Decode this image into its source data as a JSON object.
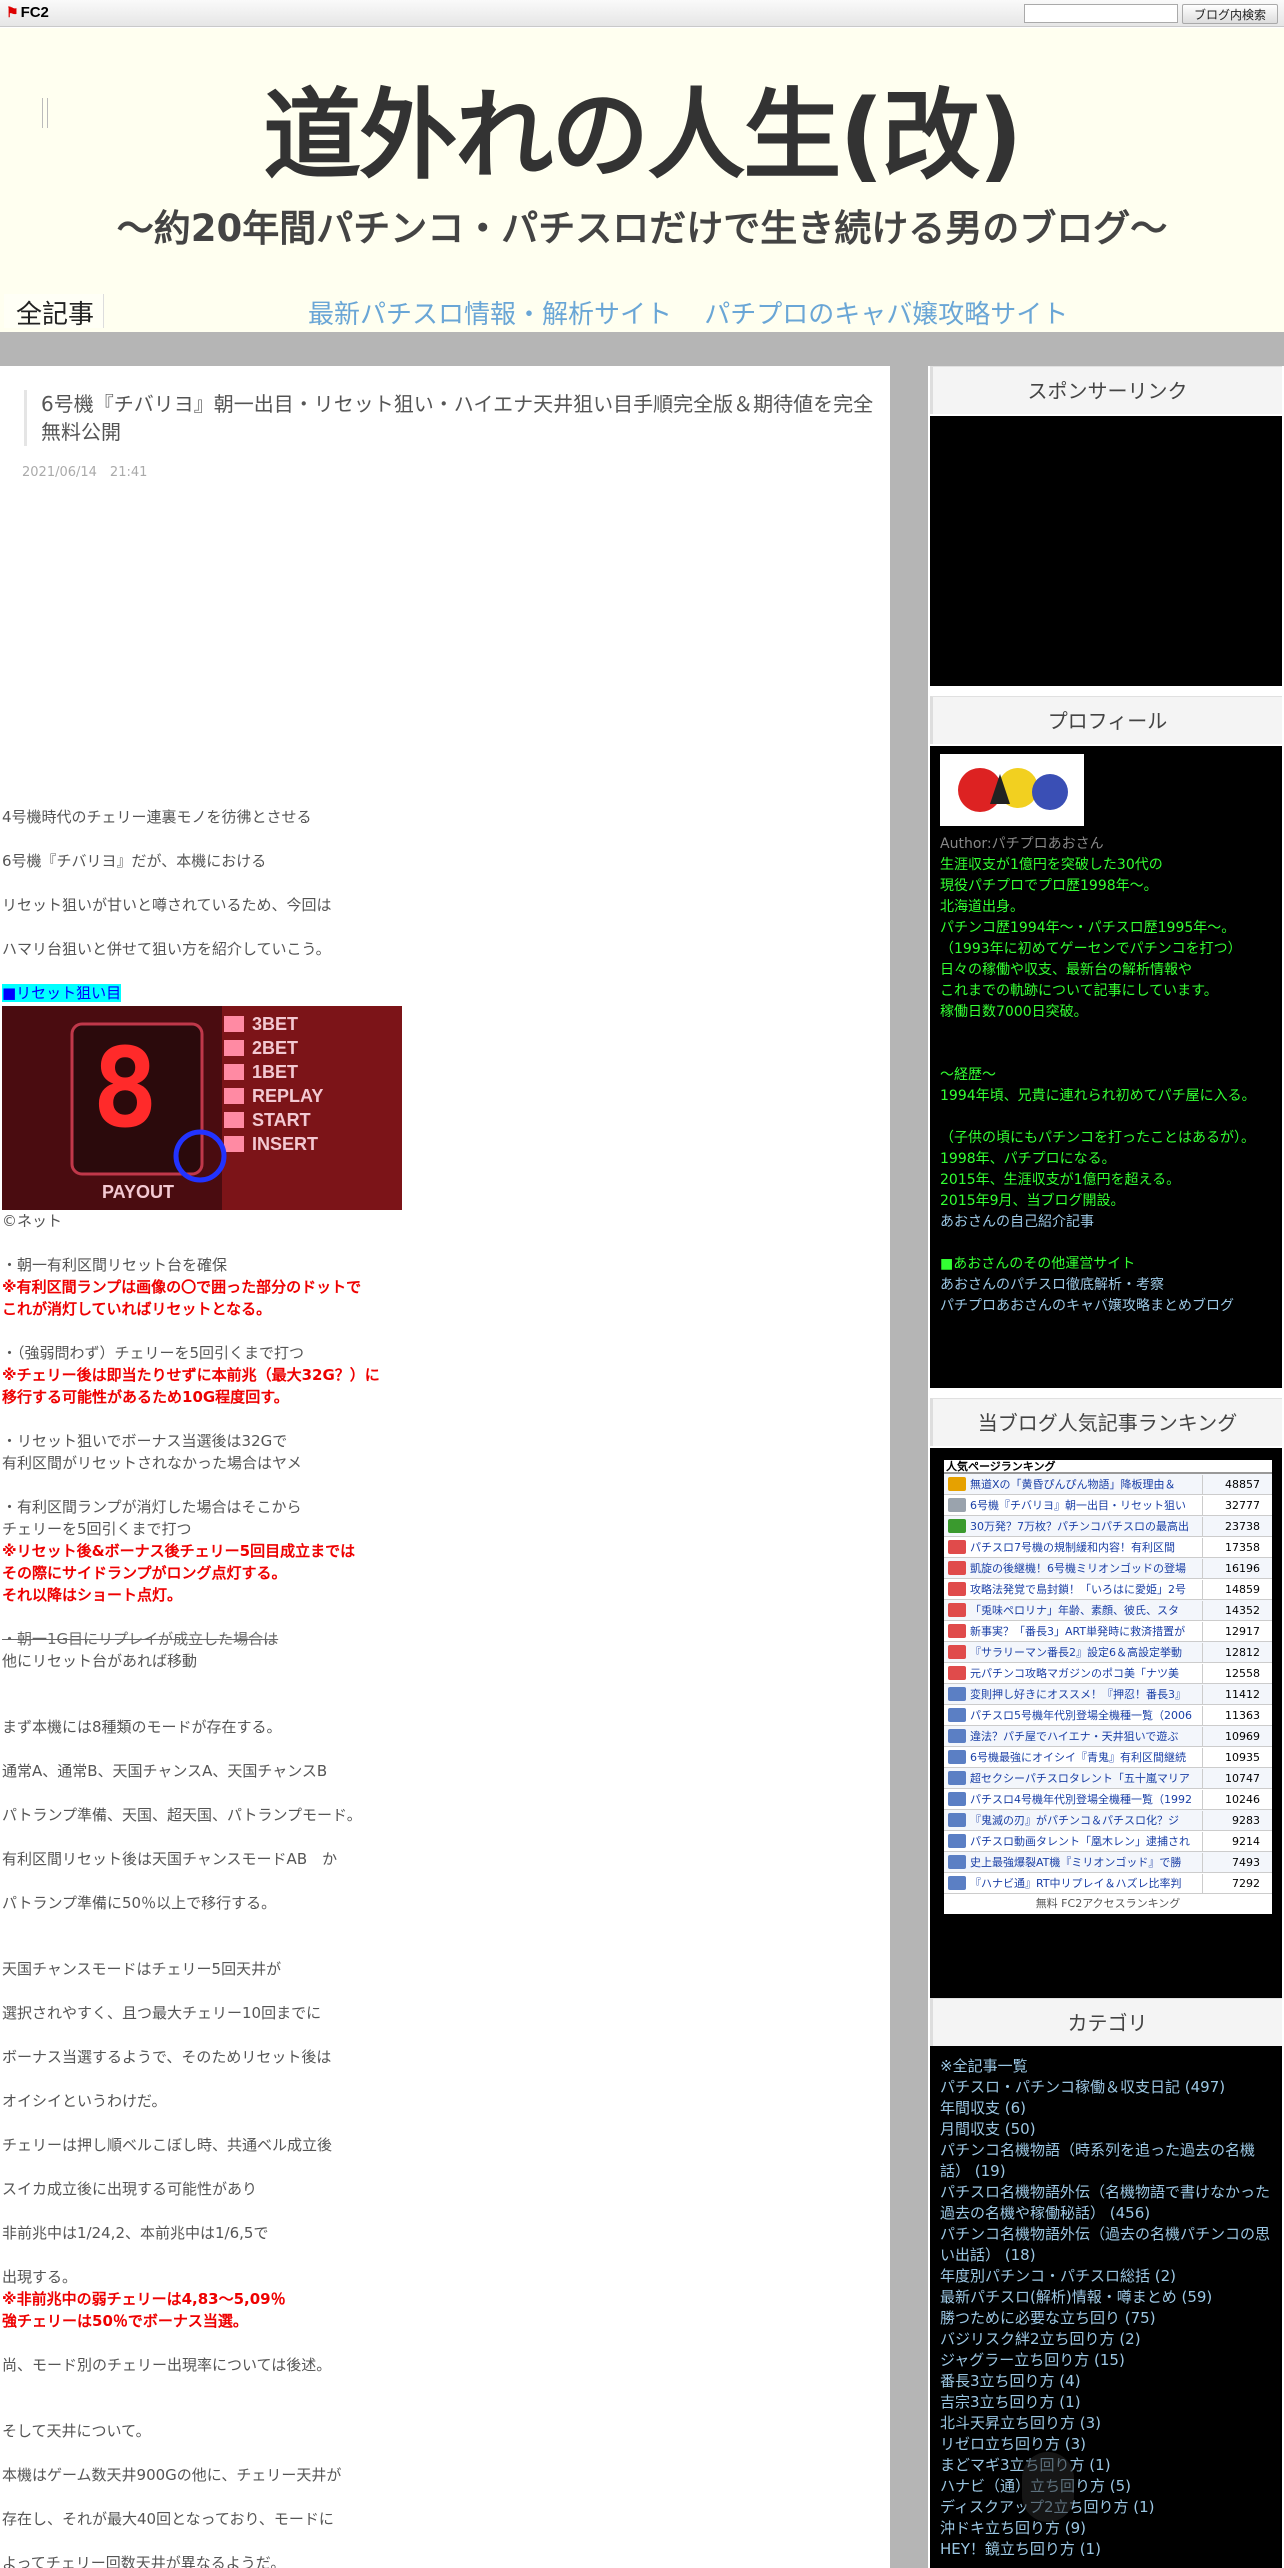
{
  "topbar": {
    "logo": "FC2",
    "search_placeholder": "",
    "search_button": "ブログ内検索"
  },
  "header": {
    "title": "道外れの人生(改)",
    "subtitle": "～約20年間パチンコ・パチスロだけで生き続ける男のブログ～",
    "all_posts": "全記事",
    "links": [
      "最新パチスロ情報・解析サイト",
      "パチプロのキャバ嬢攻略サイト"
    ]
  },
  "post": {
    "title": "6号機『チバリヨ』朝一出目・リセット狙い・ハイエナ天井狙い目手順完全版＆期待値を完全無料公開",
    "date": "2021/06/14　21:41",
    "intro": [
      "4号機時代のチェリー連裏モノを彷彿とさせる",
      "6号機『チバリヨ』だが、本機における",
      "リセット狙いが甘いと噂されているため、今回は",
      "ハマリ台狙いと併せて狙い方を紹介していこう。"
    ],
    "reset_heading": "■リセット狙い目",
    "photo_caption": "©ネット",
    "photo_labels": [
      "3BET",
      "2BET",
      "1BET",
      "REPLAY",
      "START",
      "INSERT",
      "PAYOUT"
    ],
    "list1": "・朝一有利区間リセット台を確保",
    "list1_red": [
      "※有利区間ランプは画像の〇で囲った部分のドットで",
      "これが消灯していればリセットとなる。"
    ],
    "list2": "・（強弱問わず）チェリーを5回引くまで打つ",
    "list2_red": [
      "※チェリー後は即当たりせずに本前兆（最大32G？）に",
      "移行する可能性があるため10G程度回す。"
    ],
    "list3": [
      "・リセット狙いでボーナス当選後は32Gで",
      "有利区間がリセットされなかった場合はヤメ"
    ],
    "list4": [
      "・有利区間ランプが消灯した場合はそこから",
      "チェリーを5回引くまで打つ"
    ],
    "list4_red": [
      "※リセット後&ボーナス後チェリー5回目成立までは",
      "その際にサイドランプがロング点灯する。",
      "それ以降はショート点灯。"
    ],
    "strike": "・朝一1G目にリプレイが成立した場合は",
    "strike_after": "他にリセット台があれば移動",
    "mode_lines": [
      "まず本機には8種類のモードが存在する。",
      "通常A、通常B、天国チャンスA、天国チャンスB",
      "パトランプ準備、天国、超天国、パトランプモード。",
      "有利区間リセット後は天国チャンスモードAB　か",
      "パトランプ準備に50％以上で移行する。"
    ],
    "tengoku_lines": [
      "天国チャンスモードはチェリー5回天井が",
      "選択されやすく、且つ最大チェリー10回までに",
      "ボーナス当選するようで、そのためリセット後は",
      "オイシイというわけだ。",
      "チェリーは押し順ベルこぼし時、共通ベル成立後",
      "スイカ成立後に出現する可能性があり",
      "非前兆中は1/24,2、本前兆中は1/6,5で",
      "出現する。"
    ],
    "cherry_red": [
      "※非前兆中の弱チェリーは4,83～5,09％",
      "強チェリーは50％でボーナス当選。"
    ],
    "mode_note": "尚、モード別のチェリー出現率については後述。",
    "tenjo_lines": [
      "そして天井について。",
      "本機はゲーム数天井900Gの他に、チェリー天井が",
      "存在し、それが最大40回となっており、モードに",
      "よってチェリー回数天井が異なるようだ。"
    ]
  },
  "sidebar": {
    "sponsor_title": "スポンサーリンク",
    "profile_title": "プロフィール",
    "profile_author": "Author:パチプロあおさん",
    "profile_lines": [
      "生涯収支が1億円を突破した30代の",
      "現役パチプロでプロ歴1998年～。",
      "北海道出身。",
      "パチンコ歴1994年～・パチスロ歴1995年～。",
      "（1993年に初めてゲーセンでパチンコを打つ）",
      "日々の稼働や収支、最新台の解析情報や",
      "これまでの軌跡について記事にしています。",
      "稼働日数7000日突破。"
    ],
    "career_lines": [
      "～経歴～",
      "1994年頃、兄貴に連れられ初めてパチ屋に入る。",
      "",
      "（子供の頃にもパチンコを打ったことはあるが）。",
      "1998年、パチプロになる。",
      "2015年、生涯収支が1億円を超える。",
      "2015年9月、当ブログ開設。"
    ],
    "intro_link": "あおさんの自己紹介記事",
    "other_title": "■あおさんのその他運営サイト",
    "other_links": [
      "あおさんのパチスロ徹底解析・考察",
      "パチプロあおさんのキャバ嬢攻略まとめブログ"
    ],
    "ranking_title": "当ブログ人気記事ランキング",
    "ranking_head": "人気ページランキング",
    "ranking": [
      {
        "title": "無道Xの「黄昏ぴんぴん物語」降板理由＆",
        "count": "48857",
        "color": "#e6a100"
      },
      {
        "title": "6号機『チバリヨ』朝一出目・リセット狙い",
        "count": "32777",
        "color": "#9aa3ad"
      },
      {
        "title": "30万発？7万枚？パチンコパチスロの最高出",
        "count": "23738",
        "color": "#3a9a2e"
      },
      {
        "title": "パチスロ7号機の規制緩和内容！有利区間",
        "count": "17358",
        "color": "#e04b4b"
      },
      {
        "title": "凱旋の後継機！6号機ミリオンゴッドの登場",
        "count": "16196",
        "color": "#e04b4b"
      },
      {
        "title": "攻略法発覚で島封鎖！「いろはに愛姫」2号",
        "count": "14859",
        "color": "#e04b4b"
      },
      {
        "title": "「兎味ペロリナ」年齢、素顔、彼氏、スタ",
        "count": "14352",
        "color": "#e04b4b"
      },
      {
        "title": "新事実？「番長3」ART単発時に救済措置が",
        "count": "12917",
        "color": "#e04b4b"
      },
      {
        "title": "『サラリーマン番長2』設定6＆高設定挙動",
        "count": "12812",
        "color": "#e04b4b"
      },
      {
        "title": "元パチンコ攻略マガジンのポコ美「ナツ美",
        "count": "12558",
        "color": "#e04b4b"
      },
      {
        "title": "変則押し好きにオススメ！『押忍！番長3』",
        "count": "11412",
        "color": "#5b7fc4"
      },
      {
        "title": "パチスロ5号機年代別登場全機種一覧（2006",
        "count": "11363",
        "color": "#5b7fc4"
      },
      {
        "title": "違法？パチ屋でハイエナ・天井狙いで遊ぶ",
        "count": "10969",
        "color": "#5b7fc4"
      },
      {
        "title": "6号機最強にオイシイ『青鬼』有利区間継続",
        "count": "10935",
        "color": "#5b7fc4"
      },
      {
        "title": "超セクシーパチスロタレント「五十嵐マリア",
        "count": "10747",
        "color": "#5b7fc4"
      },
      {
        "title": "パチスロ4号機年代別登場全機種一覧（1992",
        "count": "10246",
        "color": "#5b7fc4"
      },
      {
        "title": "『鬼滅の刃』がパチンコ＆パチスロ化？ジ",
        "count": "9283",
        "color": "#5b7fc4"
      },
      {
        "title": "パチスロ動画タレント「凰木レン」逮捕され",
        "count": "9214",
        "color": "#5b7fc4"
      },
      {
        "title": "史上最強爆裂AT機『ミリオンゴッド』で勝",
        "count": "7493",
        "color": "#5b7fc4"
      },
      {
        "title": "『ハナビ通』RT中リプレイ＆ハズレ比率判",
        "count": "7292",
        "color": "#5b7fc4"
      }
    ],
    "ranking_foot": "無料 FC2アクセスランキング",
    "category_title": "カテゴリ",
    "categories": [
      "※全記事一覧",
      "パチスロ・パチンコ稼働＆収支日記 (497)",
      "年間収支 (6)",
      "月間収支 (50)",
      "パチンコ名機物語（時系列を追った過去の名機話） (19)",
      "パチスロ名機物語外伝（名機物語で書けなかった過去の名機や稼働秘話） (456)",
      "パチンコ名機物語外伝（過去の名機パチンコの思い出話） (18)",
      "年度別パチンコ・パチスロ総括 (2)",
      "最新パチスロ(解析)情報・噂まとめ (59)",
      "勝つために必要な立ち回り (75)",
      "バジリスク絆2立ち回り方 (2)",
      "ジャグラー立ち回り方 (15)",
      "番長3立ち回り方 (4)",
      "吉宗3立ち回り方 (1)",
      "北斗天昇立ち回り方 (3)",
      "リゼロ立ち回り方 (3)",
      "まどマギ3立ち回り方 (1)",
      "ハナビ（通）立ち回り方 (5)",
      "ディスクアップ2立ち回り方 (1)",
      "沖ドキ立ち回り方 (9)",
      "HEY！鏡立ち回り方 (1)"
    ]
  }
}
